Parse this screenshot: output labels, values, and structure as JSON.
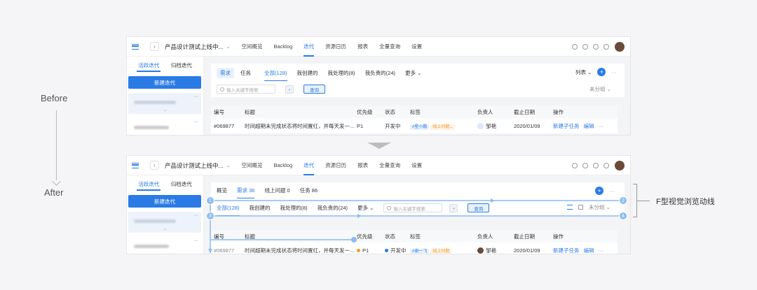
{
  "labels": {
    "before": "Before",
    "after": "After",
    "note": "F型视觉浏览动线"
  },
  "topbar": {
    "project": "产品设计测试上线中...",
    "nav": [
      "空间概览",
      "Backlog",
      "迭代",
      "资源日历",
      "报表",
      "全量查询",
      "设置"
    ],
    "active_nav": "迭代"
  },
  "sidebar": {
    "tabs": [
      "活跃迭代",
      "归档迭代"
    ],
    "new_button": "新建迭代",
    "more": "···"
  },
  "before": {
    "type_pills": [
      "需求",
      "任务"
    ],
    "filters": [
      "全部(128)",
      "我创建的",
      "我处理的(8)",
      "我负责的(24)",
      "更多"
    ],
    "view": "列表",
    "search_placeholder": "输入关键字搜索",
    "query_button": "查询",
    "group": "未分组"
  },
  "after": {
    "type_tabs": [
      "概览",
      "需求 36",
      "线上问题 0",
      "任务 86"
    ],
    "filters": [
      "全部(128)",
      "我创建的",
      "我处理的(8)",
      "我负责的(24)",
      "更多"
    ],
    "search_placeholder": "输入关键字搜索",
    "query_button": "查询",
    "group": "未分组"
  },
  "table": {
    "headers": [
      "编号",
      "标题",
      "优先级",
      "状态",
      "标签",
      "负责人",
      "截止日期",
      "操作"
    ],
    "row": {
      "id": "#069877",
      "title": "时间超期未完成状态将时间置红，并每天发一...",
      "priority": "P1",
      "status": "开发中",
      "tags_before": [
        "#星小鹏",
        "线上问题..."
      ],
      "tags_after": [
        "#谢一飞",
        "线上问题"
      ],
      "owner": "邹艳",
      "due": "2020/01/09",
      "actions": [
        "新建子任务",
        "编辑"
      ],
      "more": "···"
    }
  },
  "flow_markers": [
    "1",
    "2",
    "3",
    "4"
  ],
  "colors": {
    "accent": "#2a7be6",
    "flow": "#8cbcf0"
  }
}
